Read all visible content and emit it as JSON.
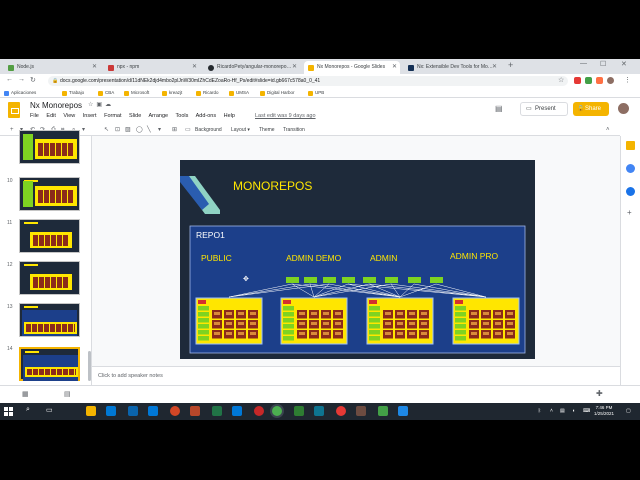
{
  "browser": {
    "tabs": [
      {
        "label": "Node.js",
        "color": "#539e43"
      },
      {
        "label": "npx - npm",
        "color": "#cb3837"
      },
      {
        "label": "RicardoPety/angular-monorepo…",
        "color": "#24292e"
      },
      {
        "label": "Nx Monorepos - Google Slides",
        "color": "#f4b400"
      },
      {
        "label": "Nx: Extensible Dev Tools for Mo…",
        "color": "#143055"
      }
    ],
    "new_tab": "+",
    "url": "docs.google.com/presentation/d/11dNEk2djd4mbo2plJnW30mIZhCdEZoaRo-Hf_Ps/edit#slide=id.gb667c578a0_0_41",
    "bookmarks": [
      {
        "label": "Aplicaciones",
        "color": "#4285f4"
      },
      {
        "label": "Trabajo",
        "color": "#f4b400"
      },
      {
        "label": "CBA",
        "color": "#f4b400"
      },
      {
        "label": "Microsoft",
        "color": "#f4b400"
      },
      {
        "label": "kreazjt",
        "color": "#f4b400"
      },
      {
        "label": "Ricardo",
        "color": "#f4b400"
      },
      {
        "label": "UMSA",
        "color": "#f4b400"
      },
      {
        "label": "Digital Harbor",
        "color": "#f4b400"
      },
      {
        "label": "UPB",
        "color": "#f4b400"
      }
    ]
  },
  "app": {
    "title": "Nx Monorepos",
    "menus": [
      "File",
      "Edit",
      "View",
      "Insert",
      "Format",
      "Slide",
      "Arrange",
      "Tools",
      "Add-ons",
      "Help"
    ],
    "last_edit": "Last edit was 9 days ago",
    "present_label": "Present",
    "share_label": "Share",
    "accent": "#f4b400"
  },
  "toolbar": {
    "background": "Background",
    "layout": "Layout ▾",
    "theme": "Theme",
    "transition": "Transition"
  },
  "filmstrip": {
    "numbers": [
      "",
      "10",
      "11",
      "12",
      "13",
      "14"
    ]
  },
  "slide": {
    "title": "MONOREPOS",
    "repo_label": "REPO1",
    "apps": [
      "PUBLIC",
      "ADMIN DEMO",
      "ADMIN",
      "ADMIN PRO"
    ],
    "colors": {
      "bg": "#1e2a3a",
      "repo": "#1c3f8a",
      "title": "#ffe600",
      "lib": "#7ed321",
      "app": "#ffe600",
      "img": "#8b2a1a"
    }
  },
  "notes": {
    "placeholder": "Click to add speaker notes"
  },
  "taskbar": {
    "time": "7:46 PM",
    "date": "1/25/2021"
  }
}
